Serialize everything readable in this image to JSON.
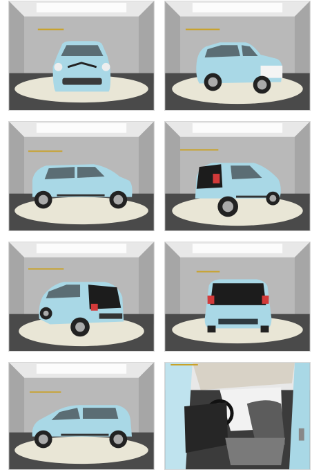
{
  "colors": {
    "car_body": "#a9d8e6",
    "car_shadow": "#7fb3c4",
    "wall": "#b9b9b9",
    "floor": "#4a4a4a",
    "turntable": "#e9e6d6",
    "ceiling": "#e8e8e8",
    "logo_gold": "#c9a227"
  },
  "photos": [
    {
      "view": "front"
    },
    {
      "view": "front-three-quarter"
    },
    {
      "view": "side-right"
    },
    {
      "view": "rear-three-quarter-right"
    },
    {
      "view": "rear-three-quarter-left"
    },
    {
      "view": "rear"
    },
    {
      "view": "side-left"
    },
    {
      "view": "interior"
    }
  ]
}
